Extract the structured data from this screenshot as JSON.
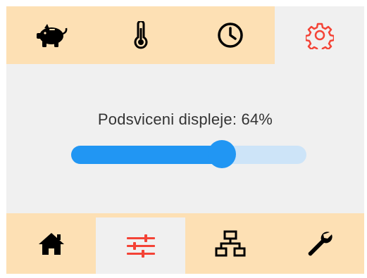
{
  "top_tabs": [
    {
      "icon": "piggy-bank-icon",
      "active": false
    },
    {
      "icon": "thermometer-icon",
      "active": false
    },
    {
      "icon": "clock-icon",
      "active": false
    },
    {
      "icon": "gear-icon",
      "active": true
    }
  ],
  "backlight": {
    "label": "Podsviceni displeje: 64%",
    "value_percent": 64
  },
  "bottom_tabs": [
    {
      "icon": "home-icon",
      "active": false
    },
    {
      "icon": "sliders-icon",
      "active": true
    },
    {
      "icon": "network-icon",
      "active": false
    },
    {
      "icon": "wrench-icon",
      "active": false
    }
  ],
  "colors": {
    "bar_background": "#fde0b4",
    "panel_background": "#f0f0f0",
    "active_icon": "#f44336",
    "slider_accent": "#2196f3",
    "slider_track": "#cde4f8"
  }
}
